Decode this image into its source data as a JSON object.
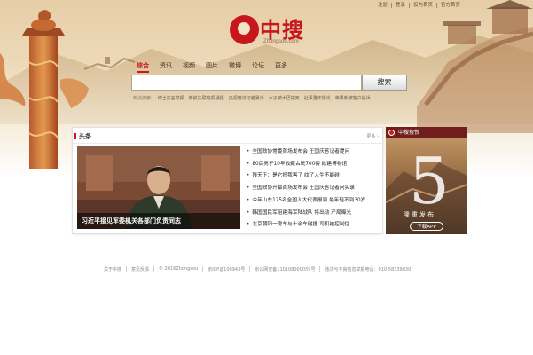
{
  "top_links": [
    "注册",
    "登录",
    "设为首页",
    "官方首页"
  ],
  "logo": {
    "cn": "中搜",
    "en": "Zhongsou.com"
  },
  "search": {
    "tabs": [
      "综合",
      "资讯",
      "视频",
      "图片",
      "微博",
      "论坛",
      "更多"
    ],
    "active_tab": "综合",
    "query": "",
    "button": "搜索",
    "hot_label": "热点搜索:",
    "hot_words": [
      "博士实名举报",
      "新航失联班机通报",
      "央视暗访记者暴光",
      "女子被大巴撞死",
      "社事重庆爆光",
      "苹果新被客户投诉"
    ]
  },
  "headlines": {
    "title": "头条",
    "more": "更多 ›",
    "photo_caption": "习近平接见军委机关各部门负责同志",
    "items": [
      "全国政协常委首场发布会 王国庆答记者提问",
      "80后男子10年收藏古玩700套 欲建博物馆",
      "残天下：是它把我害了 纹了人生不能碰！",
      "全国政协开幕首场发布会 王国庆答记者问实录",
      "今年山东175名全国人大代表报到 最年轻不到30岁",
      "韩国国民军组建海军陆战队 将出动 产局曝光",
      "北京朝阳一房车与十余车碰撞 司机被控制住"
    ]
  },
  "promo": {
    "header": "中搜搜悦",
    "number": "5",
    "subtitle": "隆重发布",
    "download": "下载APP"
  },
  "footer": [
    "关于中搜",
    "意见反馈",
    "© 2016Zhongsou",
    "京ICP证100943号",
    "京公网安备110108000059号",
    "违法与不良信息举报电话：010-58339830"
  ],
  "colors": {
    "brand_red": "#c8161d",
    "hero_tan": "#e6cda6"
  }
}
